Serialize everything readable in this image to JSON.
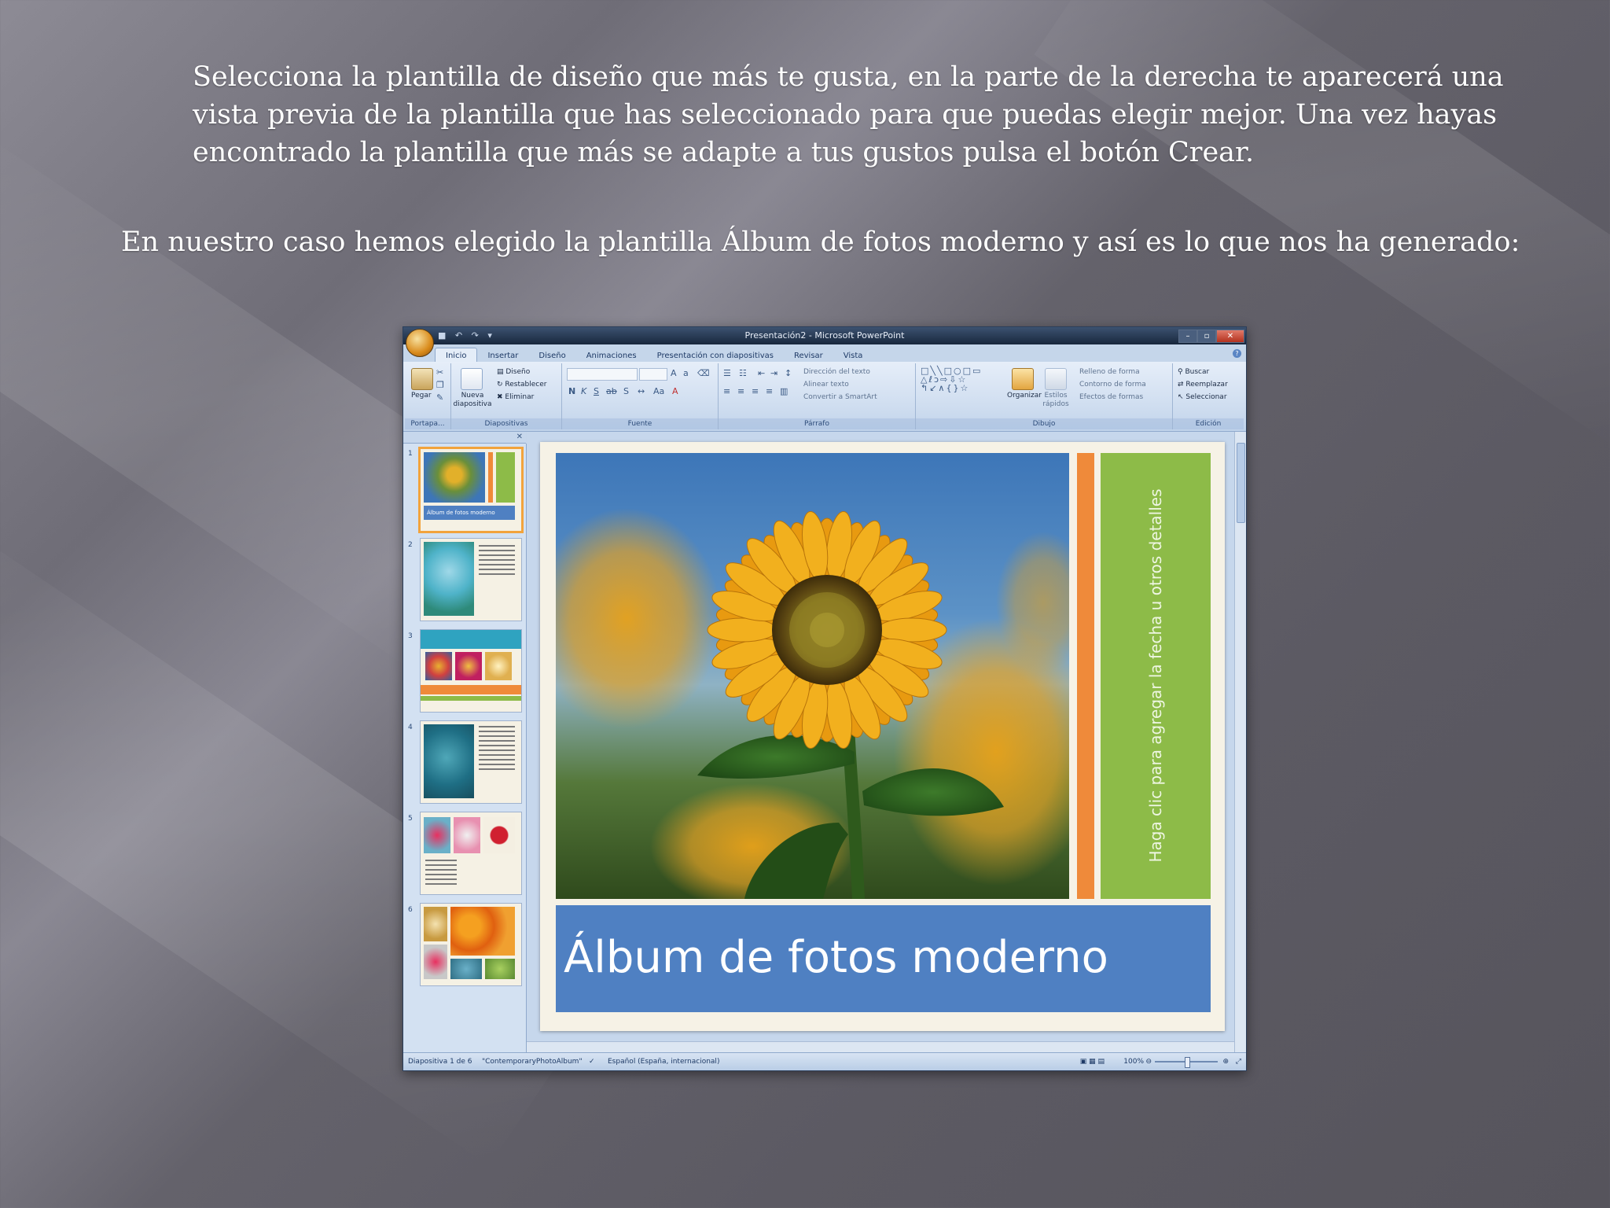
{
  "paragraphs": {
    "intro": "Selecciona la plantilla de diseño que más te gusta, en la parte de la derecha te aparecerá una vista previa de la plantilla que has seleccionado para que puedas elegir mejor. Una vez hayas encontrado la plantilla que más se adapte a tus gustos pulsa el botón Crear.",
    "result": "En nuestro caso hemos elegido la plantilla Álbum de fotos moderno y así es lo que nos ha generado:"
  },
  "window": {
    "title": "Presentación2 - Microsoft PowerPoint",
    "tabs": [
      "Inicio",
      "Insertar",
      "Diseño",
      "Animaciones",
      "Presentación con diapositivas",
      "Revisar",
      "Vista"
    ],
    "active_tab": "Inicio"
  },
  "ribbon": {
    "groups": {
      "portapapeles": "Portapa...",
      "diapositivas": "Diapositivas",
      "fuente": "Fuente",
      "parrafo": "Párrafo",
      "dibujo": "Dibujo",
      "edicion": "Edición"
    },
    "buttons": {
      "pegar": "Pegar",
      "nueva_diapositiva": "Nueva diapositiva",
      "diseno": "Diseño",
      "restablecer": "Restablecer",
      "eliminar": "Eliminar",
      "direccion_texto": "Dirección del texto",
      "alinear_texto": "Alinear texto",
      "convertir_smartart": "Convertir a SmartArt",
      "organizar": "Organizar",
      "estilos_rapidos": "Estilos rápidos",
      "relleno_forma": "Relleno de forma",
      "contorno_forma": "Contorno de forma",
      "efectos_formas": "Efectos de formas",
      "buscar": "Buscar",
      "reemplazar": "Reemplazar",
      "seleccionar": "Seleccionar"
    }
  },
  "slide": {
    "title": "Álbum de fotos moderno",
    "side_text": "Haga clic para agregar la fecha u otros detalles"
  },
  "thumbnails": {
    "numbers": [
      "1",
      "2",
      "3",
      "4",
      "5",
      "6"
    ],
    "thumb1_caption": "Álbum de fotos moderno"
  },
  "statusbar": {
    "slide_info": "Diapositiva 1 de 6",
    "theme": "\"ContemporaryPhotoAlbum\"",
    "language": "Español (España, internacional)",
    "zoom": "100%"
  },
  "colors": {
    "slide_title_bg": "#4f80c2",
    "orange_accent": "#ef8a3a",
    "green_accent": "#8dbb48",
    "selected_thumb_border": "#f2a33c"
  }
}
